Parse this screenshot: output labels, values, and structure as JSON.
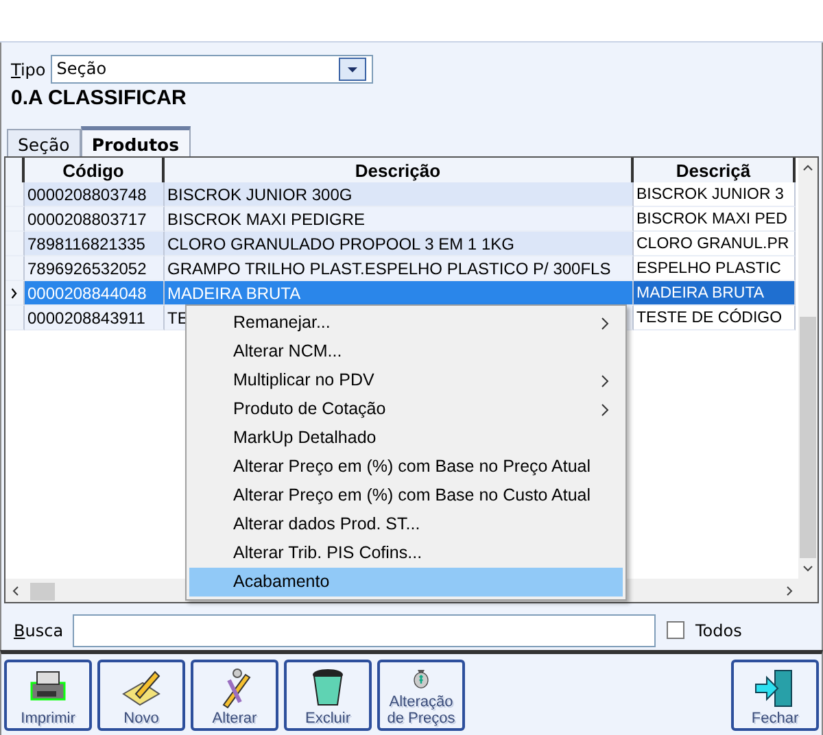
{
  "tipo": {
    "label": "Tipo",
    "value": "Seção"
  },
  "section_name": "0.A CLASSIFICAR",
  "tabs": [
    {
      "label": "Seção",
      "selected": false
    },
    {
      "label": "Produtos",
      "selected": true
    }
  ],
  "table": {
    "columns": [
      "Código",
      "Descrição",
      "Descriçã"
    ],
    "rows": [
      {
        "cells": [
          "0000208803748",
          "BISCROK JUNIOR 300G",
          "BISCROK JUNIOR 3"
        ],
        "selected": false
      },
      {
        "cells": [
          "0000208803717",
          "BISCROK MAXI PEDIGRE",
          "BISCROK MAXI PED"
        ],
        "selected": false
      },
      {
        "cells": [
          "7898116821335",
          "CLORO GRANULADO PROPOOL 3 EM 1 1KG",
          "CLORO GRANUL.PR"
        ],
        "selected": false
      },
      {
        "cells": [
          "7896926532052",
          "GRAMPO TRILHO PLAST.ESPELHO PLASTICO P/ 300FLS",
          "ESPELHO PLASTIC"
        ],
        "selected": false
      },
      {
        "cells": [
          "0000208844048",
          "MADEIRA BRUTA",
          "MADEIRA BRUTA"
        ],
        "selected": true
      },
      {
        "cells": [
          "0000208843911",
          "TE",
          "TESTE DE CÓDIGO"
        ],
        "selected": false
      }
    ]
  },
  "context_menu": {
    "items": [
      {
        "label": "Remanejar...",
        "submenu": true,
        "highlighted": false
      },
      {
        "label": "Alterar NCM...",
        "submenu": false,
        "highlighted": false
      },
      {
        "label": "Multiplicar no PDV",
        "submenu": true,
        "highlighted": false
      },
      {
        "label": "Produto de Cotação",
        "submenu": true,
        "highlighted": false
      },
      {
        "label": "MarkUp Detalhado",
        "submenu": false,
        "highlighted": false
      },
      {
        "label": "Alterar Preço em (%) com Base no Preço Atual",
        "submenu": false,
        "highlighted": false
      },
      {
        "label": "Alterar Preço em (%) com Base no Custo Atual",
        "submenu": false,
        "highlighted": false
      },
      {
        "label": "Alterar dados Prod. ST...",
        "submenu": false,
        "highlighted": false
      },
      {
        "label": "Alterar Trib. PIS Cofins...",
        "submenu": false,
        "highlighted": false
      },
      {
        "label": "Acabamento",
        "submenu": false,
        "highlighted": true
      }
    ]
  },
  "search": {
    "label": "Busca"
  },
  "todos": {
    "label": "Todos",
    "checked": false
  },
  "toolbar": [
    {
      "label": "Imprimir",
      "kind": "printer"
    },
    {
      "label": "Novo",
      "kind": "new"
    },
    {
      "label": "Alterar",
      "kind": "edit"
    },
    {
      "label": "Excluir",
      "kind": "trash"
    },
    {
      "label": "Alteração de Preços",
      "kind": "money"
    },
    {
      "label": "Fechar",
      "kind": "exit"
    }
  ]
}
